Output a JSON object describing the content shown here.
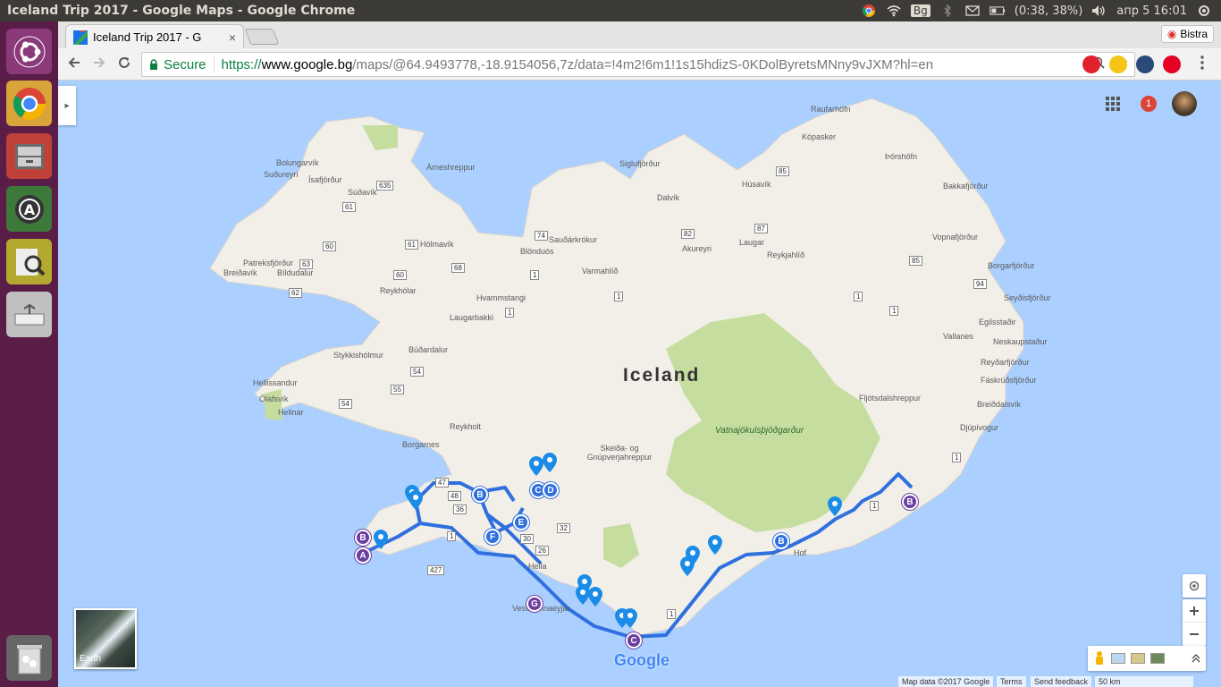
{
  "window_title": "Iceland Trip 2017 - Google Maps - Google Chrome",
  "tray": {
    "keyboard_layout": "Bg",
    "battery": "(0:38, 38%)",
    "datetime": "апр  5 16:01"
  },
  "tab": {
    "label": "Iceland Trip 2017 - G",
    "close": "×"
  },
  "profile": {
    "name": "Bistra"
  },
  "omnibox": {
    "secure_label": "Secure",
    "url_scheme": "https://",
    "url_host": "www.google.bg",
    "url_path": "/maps/@64.9493778,-18.9154056,7z/data=!4m2!6m1!1s15hdizS-0KDolByretsMNny9vJXM?hl=en"
  },
  "map": {
    "country_label": "Iceland",
    "park_label": "Vatnajökulsþjóðgarður",
    "places": [
      "Raufarhöfn",
      "Kópasker",
      "Bolungarvík",
      "Súðavík",
      "Ísafjörður",
      "Suðureyri",
      "Árneshreppur",
      "Siglufjörður",
      "Dalvík",
      "Húsavík",
      "Þórshöfn",
      "Bakkafjörður",
      "Vopnafjörður",
      "Bíldudalur",
      "Hólmavík",
      "Patreksfjörður",
      "Sauðárkrókur",
      "Akureyri",
      "Laugar",
      "Reykjahlíð",
      "Breiðavík",
      "Blönduós",
      "Varmahlíð",
      "Reykhólar",
      "Hvammstangi",
      "Laugarbakki",
      "Borgarfjörður",
      "Húsavík",
      "Seyðisfjörður",
      "Egilsstaðir",
      "Vallanes",
      "Neskaupstaður",
      "Búðardalur",
      "Stykkishólmur",
      "Reyðarfjörður",
      "Fáskrúðsfjörður",
      "Hellissandur",
      "Ólafsvík",
      "Hellnar",
      "Breiðdalsvík",
      "Fljótsdalshreppur",
      "Djúpivogur",
      "Reykholt",
      "Borgarnes",
      "Skeiða- og Gnúpverjahreppur",
      "Hella",
      "Vestmannaeyjar",
      "Hof"
    ],
    "route_shields": [
      "635",
      "61",
      "60",
      "61",
      "68",
      "74",
      "1",
      "82",
      "87",
      "85",
      "85",
      "94",
      "1",
      "63",
      "62",
      "60",
      "1",
      "1",
      "1",
      "54",
      "55",
      "54",
      "47",
      "48",
      "36",
      "1",
      "30",
      "32",
      "26",
      "427",
      "1",
      "1",
      "1"
    ],
    "markers": [
      {
        "label": "A",
        "color": "#6b3fa0"
      },
      {
        "label": "B",
        "color": "#6b3fa0"
      },
      {
        "label": "B",
        "color": "#2f6fde"
      },
      {
        "label": "C",
        "color": "#2f6fde"
      },
      {
        "label": "D",
        "color": "#2f6fde"
      },
      {
        "label": "E",
        "color": "#2f6fde"
      },
      {
        "label": "F",
        "color": "#2f6fde"
      },
      {
        "label": "G",
        "color": "#6b3fa0"
      },
      {
        "label": "C",
        "color": "#6b3fa0"
      },
      {
        "label": "B",
        "color": "#2f6fde"
      },
      {
        "label": "B",
        "color": "#6b3fa0"
      }
    ],
    "notification_count": "1",
    "earth_label": "Earth",
    "google_logo": "Google",
    "footer": {
      "map_data": "Map data ©2017 Google",
      "terms": "Terms",
      "feedback": "Send feedback",
      "scale": "50 km"
    },
    "colors": {
      "route": "#2f6fde",
      "water": "#abd0ff",
      "land": "#f2efe9",
      "park": "#c5dea0"
    }
  }
}
